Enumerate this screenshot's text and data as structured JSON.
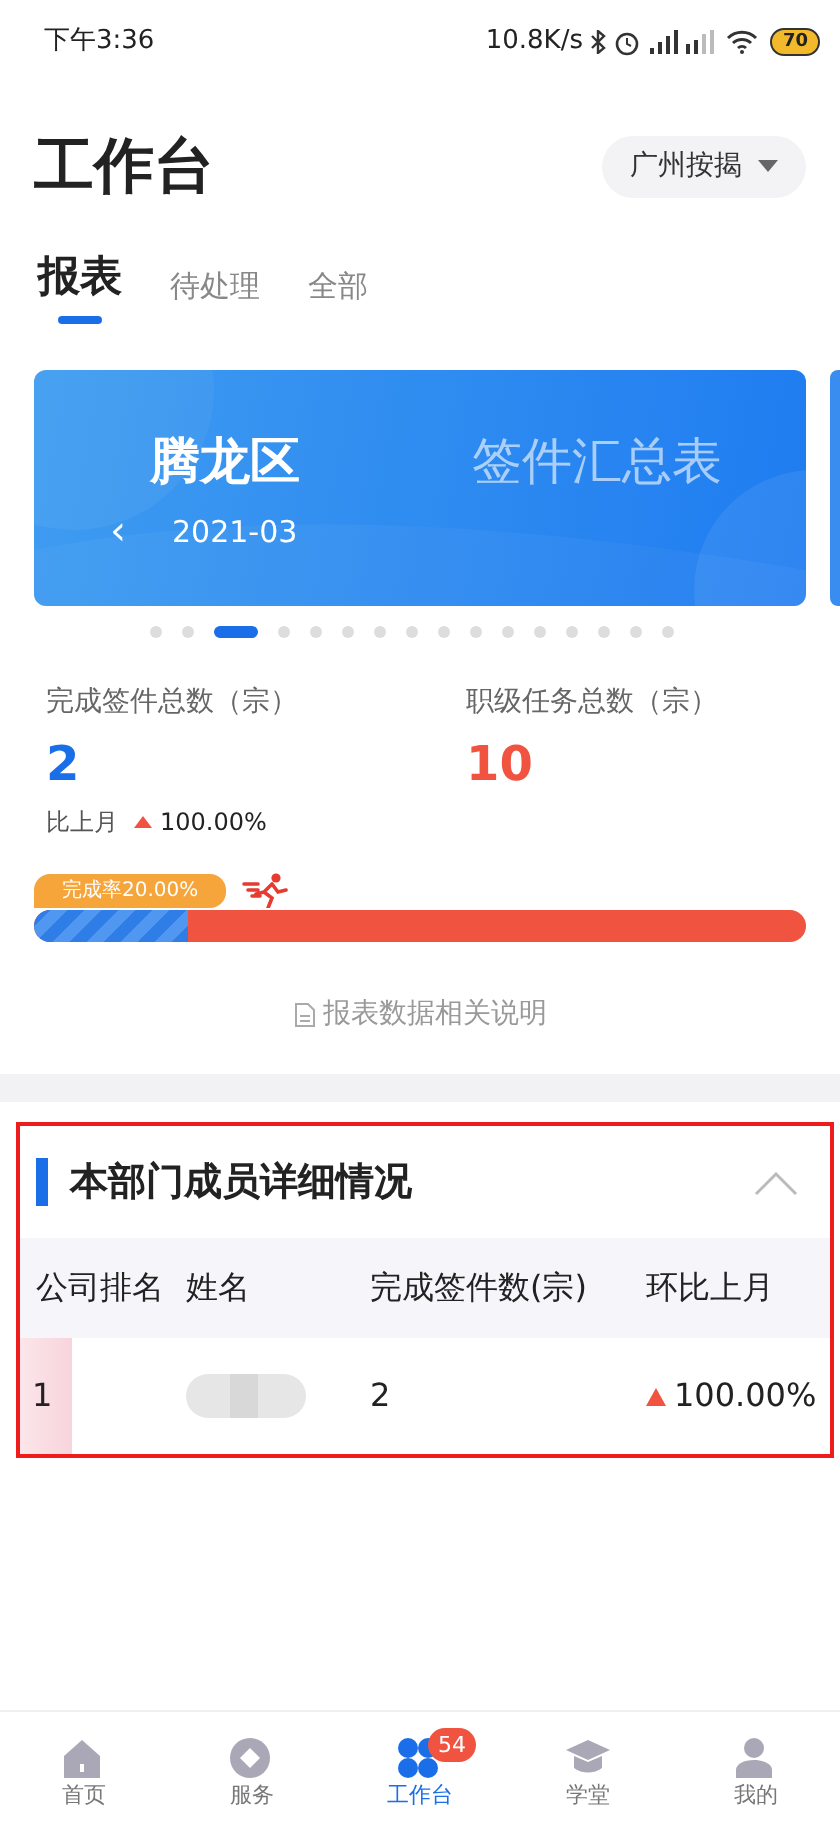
{
  "status_bar": {
    "time": "下午3:36",
    "speed": "10.8K/s",
    "battery": "70"
  },
  "header": {
    "title": "工作台",
    "region_select": "广州按揭"
  },
  "tabs": [
    {
      "label": "报表",
      "selected": true
    },
    {
      "label": "待处理",
      "selected": false
    },
    {
      "label": "全部",
      "selected": false
    }
  ],
  "banner": {
    "district": "腾龙区",
    "report_name": "签件汇总表",
    "prev_arrow": "‹",
    "month": "2021-03"
  },
  "carousel_dots": [
    {
      "selected": false
    },
    {
      "selected": false
    },
    {
      "selected": true
    },
    {
      "selected": false
    },
    {
      "selected": false
    },
    {
      "selected": false
    },
    {
      "selected": false
    },
    {
      "selected": false
    },
    {
      "selected": false
    },
    {
      "selected": false
    },
    {
      "selected": false
    },
    {
      "selected": false
    },
    {
      "selected": false
    },
    {
      "selected": false
    },
    {
      "selected": false
    },
    {
      "selected": false
    }
  ],
  "stats": [
    {
      "label": "完成签件总数（宗）",
      "value": "2",
      "color": "#1a6fe8"
    },
    {
      "label": "职级任务总数（宗）",
      "value": "10",
      "color": "#f0533f"
    }
  ],
  "compare": {
    "label": "比上月",
    "value": "100.00%"
  },
  "progress": {
    "badge": "完成率20.00%",
    "level": 0.2
  },
  "note": "报表数据相关说明",
  "section": {
    "title": "本部门成员详细情况",
    "expanded": true,
    "table": {
      "columns": [
        "公司排名",
        "姓名",
        "完成签件数(宗)",
        "环比上月"
      ],
      "rows": [
        {
          "rank": "1",
          "count": "2",
          "change": "100.00%"
        }
      ]
    }
  },
  "bottom_nav": [
    {
      "label": "首页",
      "selected": false
    },
    {
      "label": "服务",
      "selected": false
    },
    {
      "label": "工作台",
      "selected": true,
      "badge": "54"
    },
    {
      "label": "学堂",
      "selected": false
    },
    {
      "label": "我的",
      "selected": false
    }
  ]
}
